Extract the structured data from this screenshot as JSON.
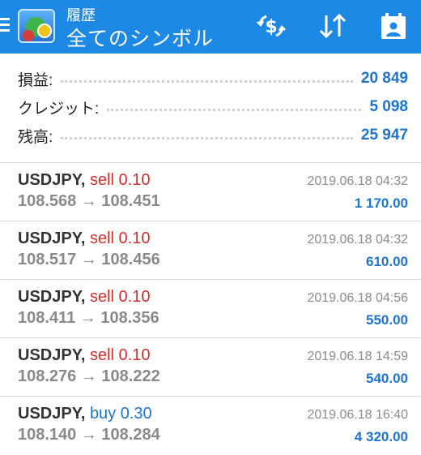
{
  "header": {
    "subtitle": "履歴",
    "title": "全てのシンボル",
    "background_color": "#1e88e5",
    "icons": [
      "menu-icon",
      "app-logo",
      "currency-exchange-icon",
      "sort-icon",
      "calendar-person-icon"
    ]
  },
  "summary": {
    "items": [
      {
        "label": "損益:",
        "value": "20 849"
      },
      {
        "label": "クレジット:",
        "value": "5 098"
      },
      {
        "label": "残高:",
        "value": "25 947"
      }
    ],
    "value_color": "#1b75d0"
  },
  "trades": [
    {
      "symbol": "USDJPY,",
      "side": "sell",
      "volume": "0.10",
      "open_price": "108.568",
      "close_price": "108.451",
      "time": "2019.06.18 04:32",
      "profit": "1 170.00"
    },
    {
      "symbol": "USDJPY,",
      "side": "sell",
      "volume": "0.10",
      "open_price": "108.517",
      "close_price": "108.456",
      "time": "2019.06.18 04:32",
      "profit": "610.00"
    },
    {
      "symbol": "USDJPY,",
      "side": "sell",
      "volume": "0.10",
      "open_price": "108.411",
      "close_price": "108.356",
      "time": "2019.06.18 04:56",
      "profit": "550.00"
    },
    {
      "symbol": "USDJPY,",
      "side": "sell",
      "volume": "0.10",
      "open_price": "108.276",
      "close_price": "108.222",
      "time": "2019.06.18 14:59",
      "profit": "540.00"
    },
    {
      "symbol": "USDJPY,",
      "side": "buy",
      "volume": "0.30",
      "open_price": "108.140",
      "close_price": "108.284",
      "time": "2019.06.18 16:40",
      "profit": "4 320.00"
    }
  ],
  "colors": {
    "sell": "#d32f2f",
    "buy": "#1b75d0",
    "muted": "#8a8a8a"
  }
}
